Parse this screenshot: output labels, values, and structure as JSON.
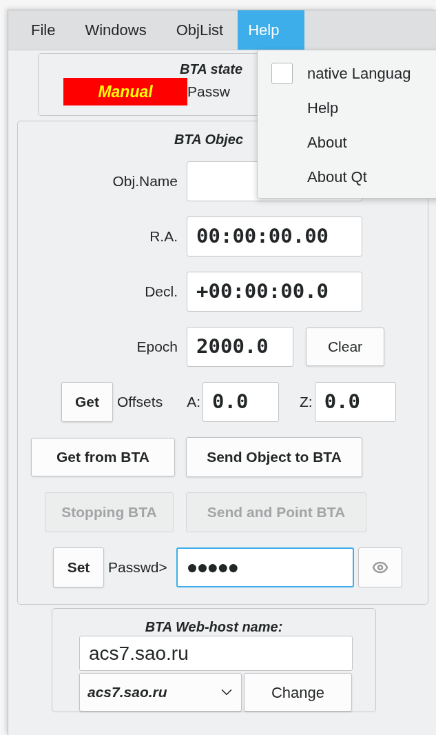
{
  "menu_bar": [
    {
      "label": "File",
      "selected": false
    },
    {
      "label": "Windows",
      "selected": false
    },
    {
      "label": "ObjList",
      "selected": false
    },
    {
      "label": "Help",
      "selected": true
    }
  ],
  "help_menu": [
    {
      "kind": "checkbox",
      "label": "native Languag",
      "checked": false
    },
    {
      "kind": "item",
      "label": "Help"
    },
    {
      "kind": "item",
      "label": "About"
    },
    {
      "kind": "item",
      "label": "About Qt"
    }
  ],
  "state_panel": {
    "title": "BTA state",
    "mode": "Manual",
    "password_label": "Passw"
  },
  "object_panel": {
    "title": "BTA Objec",
    "obj_name": {
      "label": "Obj.Name"
    },
    "ra": {
      "label": "R.A.",
      "value": "00:00:00.00"
    },
    "decl": {
      "label": "Decl.",
      "value": "+00:00:00.0"
    },
    "epoch": {
      "label": "Epoch",
      "value": "2000.0"
    },
    "clear_button": {
      "label": "Clear",
      "disabled": false
    },
    "get_button": {
      "label": "Get",
      "disabled": false
    },
    "offsets_label": "Offsets",
    "offset_a": {
      "label": "A:",
      "value": "0.0"
    },
    "offset_z": {
      "label": "Z:",
      "value": "0.0"
    },
    "action_buttons": [
      {
        "label": "Get from BTA",
        "disabled": false
      },
      {
        "label": "Send Object to BTA",
        "disabled": false
      }
    ],
    "pointing_buttons": [
      {
        "label": "Stopping BTA",
        "disabled": true
      },
      {
        "label": "Send and Point BTA",
        "disabled": true
      }
    ],
    "set_button": {
      "label": "Set",
      "disabled": false
    },
    "password": {
      "label": "Passwd>",
      "value": "●●●●●",
      "focused": true
    }
  },
  "web_host": {
    "title": "BTA Web-host name:",
    "value": "acs7.sao.ru",
    "combo": "acs7.sao.ru",
    "button": "Change"
  }
}
